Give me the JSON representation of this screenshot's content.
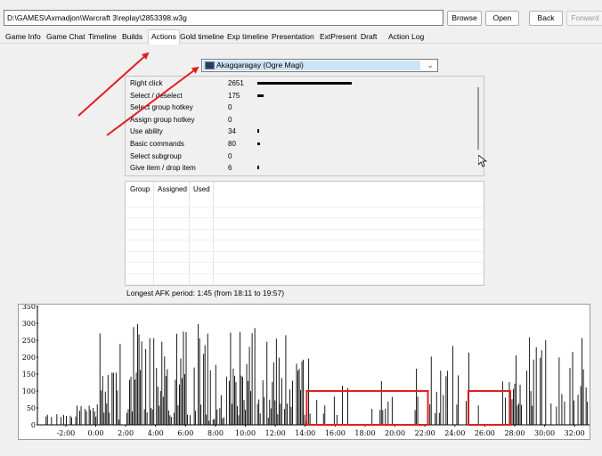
{
  "toolbar": {
    "path": "D:\\GAMES\\Axmadjon\\Warcraft 3\\replay\\2853398.w3g",
    "browse": "Browse",
    "open": "Open",
    "back": "Back",
    "forward": "Forward"
  },
  "tabs": [
    "Game Info",
    "Game Chat",
    "Timeline",
    "Builds",
    "Actions",
    "Gold timeline",
    "Exp timeline",
    "Presentation",
    "ExtPresent",
    "Draft",
    "Action Log"
  ],
  "active_tab": "Actions",
  "player_select": {
    "value": "Akagqaragay (Ogre Magi)"
  },
  "stats": [
    {
      "label": "Right click",
      "value": "2651",
      "bar": 2651
    },
    {
      "label": "Select / deselect",
      "value": "175",
      "bar": 175
    },
    {
      "label": "Select group hotkey",
      "value": "0",
      "bar": 0
    },
    {
      "label": "Assign group hotkey",
      "value": "0",
      "bar": 0
    },
    {
      "label": "Use ability",
      "value": "34",
      "bar": 34
    },
    {
      "label": "Basic commands",
      "value": "80",
      "bar": 80
    },
    {
      "label": "Select subgroup",
      "value": "0",
      "bar": 0
    },
    {
      "label": "Give item / drop item",
      "value": "6",
      "bar": 6
    }
  ],
  "groups_table": {
    "headers": [
      "Group",
      "Assigned",
      "Used"
    ]
  },
  "afk_text": "Longest AFK period: 1:45 (from 18:11 to 19:57)",
  "colors": {
    "annotation": "#e02020",
    "bars": "#000000",
    "select_highlight": "#cce4f7"
  },
  "chart_data": {
    "type": "bar",
    "y_ticks": [
      "0",
      "50",
      "100",
      "150",
      "200",
      "250",
      "300",
      "350"
    ],
    "ylim": [
      0,
      350
    ],
    "x_ticks": [
      "-2:00",
      "0:00",
      "2:00",
      "4:00",
      "6:00",
      "8:00",
      "10:00",
      "12:00",
      "14:00",
      "16:00",
      "18:00",
      "20:00",
      "22:00",
      "24:00",
      "26:00",
      "28:00",
      "30:00",
      "32:00"
    ],
    "xlim": [
      -3.9,
      33
    ],
    "annotations": [
      {
        "type": "rect",
        "x0": 14.1,
        "x1": 22.2,
        "y0": 0,
        "y1": 100
      },
      {
        "type": "rect",
        "x0": 24.9,
        "x1": 27.7,
        "y0": 0,
        "y1": 100
      }
    ]
  }
}
